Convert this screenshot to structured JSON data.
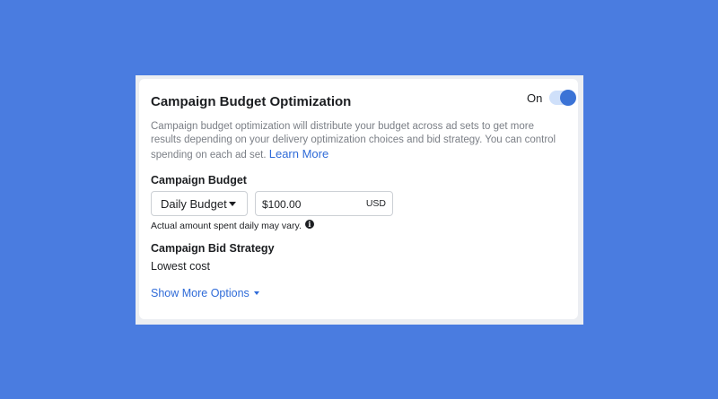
{
  "card": {
    "title": "Campaign Budget Optimization",
    "toggle_label": "On",
    "toggle_on": true,
    "description": "Campaign budget optimization will distribute your budget across ad sets to get more results depending on your delivery optimization choices and bid strategy. You can control spending on each ad set.",
    "learn_more": "Learn More"
  },
  "budget": {
    "label": "Campaign Budget",
    "type_selected": "Daily Budget",
    "amount": "$100.00",
    "currency": "USD",
    "note": "Actual amount spent daily may vary."
  },
  "bid_strategy": {
    "label": "Campaign Bid Strategy",
    "value": "Lowest cost"
  },
  "show_more": "Show More Options",
  "colors": {
    "background": "#4a7ce0",
    "accent": "#3b73d6",
    "link": "#2f6bd8"
  }
}
